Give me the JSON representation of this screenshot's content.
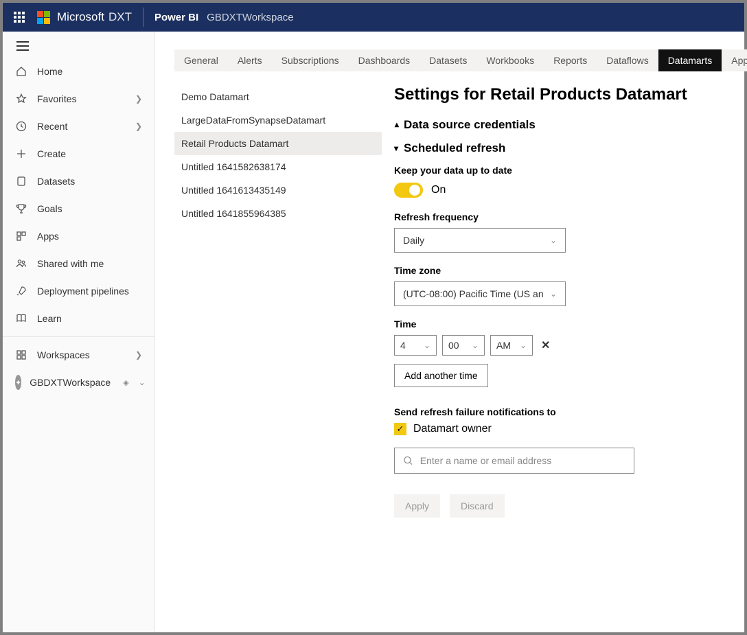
{
  "topbar": {
    "brand": "Microsoft",
    "brand_suffix": "DXT",
    "product": "Power BI",
    "workspace": "GBDXTWorkspace"
  },
  "sidebar": {
    "items": [
      {
        "label": "Home"
      },
      {
        "label": "Favorites",
        "chevron": true
      },
      {
        "label": "Recent",
        "chevron": true
      },
      {
        "label": "Create"
      },
      {
        "label": "Datasets"
      },
      {
        "label": "Goals"
      },
      {
        "label": "Apps"
      },
      {
        "label": "Shared with me"
      },
      {
        "label": "Deployment pipelines"
      },
      {
        "label": "Learn"
      }
    ],
    "workspaces_label": "Workspaces",
    "current_workspace": "GBDXTWorkspace"
  },
  "tabs": [
    "General",
    "Alerts",
    "Subscriptions",
    "Dashboards",
    "Datasets",
    "Workbooks",
    "Reports",
    "Dataflows",
    "Datamarts",
    "App"
  ],
  "active_tab": "Datamarts",
  "datamarts": [
    "Demo Datamart",
    "LargeDataFromSynapseDatamart",
    "Retail Products Datamart",
    "Untitled 1641582638174",
    "Untitled 1641613435149",
    "Untitled 1641855964385"
  ],
  "selected_datamart": "Retail Products Datamart",
  "settings": {
    "title": "Settings for Retail Products Datamart",
    "sections": {
      "credentials": "Data source credentials",
      "scheduled": "Scheduled refresh"
    },
    "scheduled": {
      "keep_label": "Keep your data up to date",
      "toggle_state": "On",
      "frequency_label": "Refresh frequency",
      "frequency_value": "Daily",
      "timezone_label": "Time zone",
      "timezone_value": "(UTC-08:00) Pacific Time (US an",
      "time_label": "Time",
      "time_hour": "4",
      "time_minute": "00",
      "time_ampm": "AM",
      "add_time": "Add another time",
      "notify_label": "Send refresh failure notifications to",
      "owner_label": "Datamart owner",
      "search_placeholder": "Enter a name or email address",
      "apply": "Apply",
      "discard": "Discard"
    }
  }
}
